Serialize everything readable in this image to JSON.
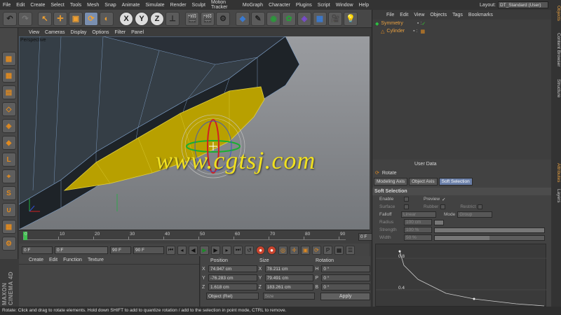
{
  "menubar": [
    "File",
    "Edit",
    "Create",
    "Select",
    "Tools",
    "Mesh",
    "Snap",
    "Animate",
    "Simulate",
    "Render",
    "Sculpt",
    "Motion Tracker",
    "MoGraph",
    "Character",
    "Plugins",
    "Script",
    "Window",
    "Help"
  ],
  "layout": {
    "label": "Layout:",
    "value": "DT_Standard (User)"
  },
  "viewport": {
    "menu": [
      "View",
      "Cameras",
      "Display",
      "Options",
      "Filter",
      "Panel"
    ],
    "label": "Perspective"
  },
  "watermark": "www.cgtsj.com",
  "timeline": {
    "ticks": [
      "0",
      "10",
      "20",
      "30",
      "40",
      "50",
      "60",
      "70",
      "80",
      "90"
    ],
    "end_field": "0 F"
  },
  "playbar": {
    "start": "0 F",
    "current": "0 F",
    "range_end": "90 F",
    "end": "90 F"
  },
  "material_menu": [
    "Create",
    "Edit",
    "Function",
    "Texture"
  ],
  "brand": "MAXON CINEMA 4D",
  "coordinates": {
    "headers": [
      "Position",
      "Size",
      "Rotation"
    ],
    "rows": [
      {
        "axis": "X",
        "pos": "74.947 cm",
        "size": "78.211 cm",
        "rot_axis": "H",
        "rot": "0 °"
      },
      {
        "axis": "Y",
        "pos": "-76.283 cm",
        "size": "79.491 cm",
        "rot_axis": "P",
        "rot": "0 °"
      },
      {
        "axis": "Z",
        "pos": "1.618 cm",
        "size": "183.261 cm",
        "rot_axis": "B",
        "rot": "0 °"
      }
    ],
    "mode": "Object (Rel)",
    "size_mode": "Size",
    "apply": "Apply"
  },
  "objects": {
    "menu": [
      "File",
      "Edit",
      "View",
      "Objects",
      "Tags",
      "Bookmarks"
    ],
    "items": [
      "Symmetry",
      "Cylinder"
    ]
  },
  "attributes": {
    "menu_partial": "User Data",
    "title": "Rotate",
    "tabs": [
      "Modeling Axis",
      "Object Axis",
      "Soft Selection"
    ],
    "section": "Soft Selection",
    "enable": "Enable",
    "preview": "Preview",
    "surface": "Surface",
    "rubber": "Rubber",
    "restrict": "Restrict",
    "falloff": "Falloff",
    "falloff_value": "Linear",
    "mode": "Mode",
    "mode_value": "Group",
    "radius": "Radius",
    "radius_value": "100 cm",
    "strength": "Strength",
    "strength_value": "100 %",
    "width": "Width",
    "width_value": "50 %",
    "graph_labels": [
      "0.8",
      "0.4"
    ]
  },
  "side_tabs": [
    "Objects",
    "Content Browser",
    "Structure",
    "Attributes",
    "Layers"
  ],
  "status": "Rotate: Click and drag to rotate elements. Hold down SHIFT to add to quantize rotation / add to the selection in point mode, CTRL to remove."
}
